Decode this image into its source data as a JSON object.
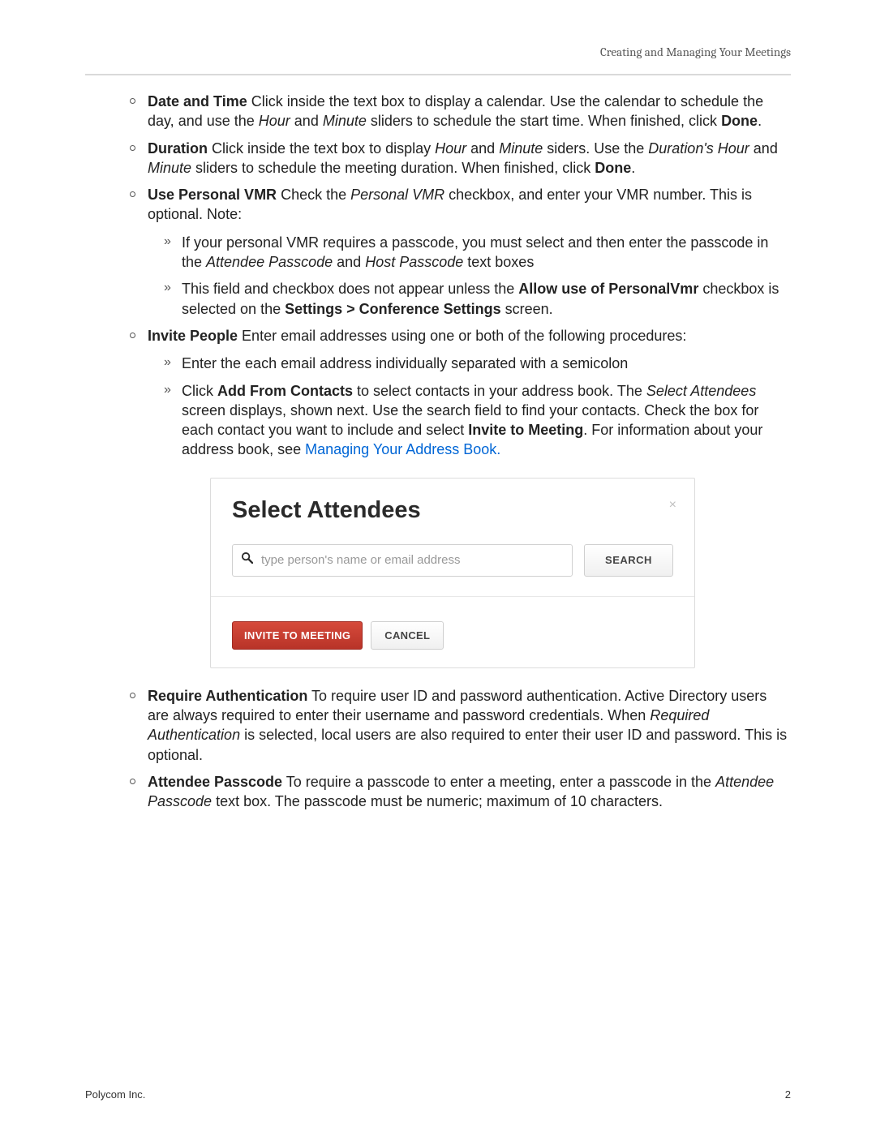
{
  "header": {
    "section_title": "Creating and Managing Your Meetings"
  },
  "bullets": {
    "date_time": {
      "title": "Date and Time",
      "text_parts": [
        "   Click inside the text box to display a calendar. Use the calendar to schedule the day, and use the ",
        "Hour",
        " and ",
        "Minute",
        " sliders to schedule the start time. When finished, click ",
        "Done",
        "."
      ]
    },
    "duration": {
      "title": "Duration",
      "text_parts": [
        "   Click inside the text box to display ",
        "Hour",
        " and ",
        "Minute",
        " siders. Use the ",
        "Duration's Hour",
        " and ",
        "Minute",
        " sliders to schedule the meeting duration. When finished, click ",
        "Done",
        "."
      ]
    },
    "use_vmr": {
      "title": "Use Personal VMR",
      "text_parts": [
        "   Check the ",
        "Personal VMR",
        " checkbox, and enter your VMR number. This is optional. Note:"
      ],
      "sub": [
        {
          "parts": [
            " If your personal VMR requires a passcode, you must select and then enter the passcode in the ",
            "Attendee Passcode",
            " and ",
            "Host Passcode",
            " text boxes"
          ]
        },
        {
          "parts": [
            "This field and checkbox does not appear unless the ",
            "Allow use of PersonalVmr",
            " checkbox is selected on the ",
            "Settings > Conference Settings",
            " screen."
          ]
        }
      ]
    },
    "invite_people": {
      "title": "Invite People",
      "text_parts": [
        "   Enter email addresses using one or both of the following procedures:"
      ],
      "sub": [
        {
          "parts": [
            "Enter the each email address individually separated with a semicolon"
          ]
        },
        {
          "parts": [
            "Click ",
            "Add From Contacts",
            " to select contacts in your address book. The ",
            "Select Attendees",
            " screen displays, shown next. Use the search field to find your contacts. Check the box for each contact you want to include and select ",
            "Invite to Meeting",
            ". For information about your address book, see ",
            "Managing Your Address Book."
          ]
        }
      ]
    },
    "require_auth": {
      "title": "Require Authentication",
      "text_parts": [
        "    To require user ID and password authentication. Active Directory users are always required to enter their username and password credentials. When ",
        "Required Authentication",
        " is selected, local users are also required to enter their user ID and password. This is optional."
      ]
    },
    "attendee_passcode": {
      "title": "Attendee Passcode",
      "text_parts": [
        "   To require a passcode to enter a meeting, enter a passcode in the ",
        "Attendee Passcode",
        " text box. The passcode must be numeric; maximum of 10 characters."
      ]
    }
  },
  "dialog": {
    "title": "Select Attendees",
    "close": "×",
    "search_placeholder": "type person's name or email address",
    "search_btn": "SEARCH",
    "invite_btn": "INVITE TO MEETING",
    "cancel_btn": "CANCEL"
  },
  "footer": {
    "company": "Polycom Inc.",
    "page": "2"
  }
}
